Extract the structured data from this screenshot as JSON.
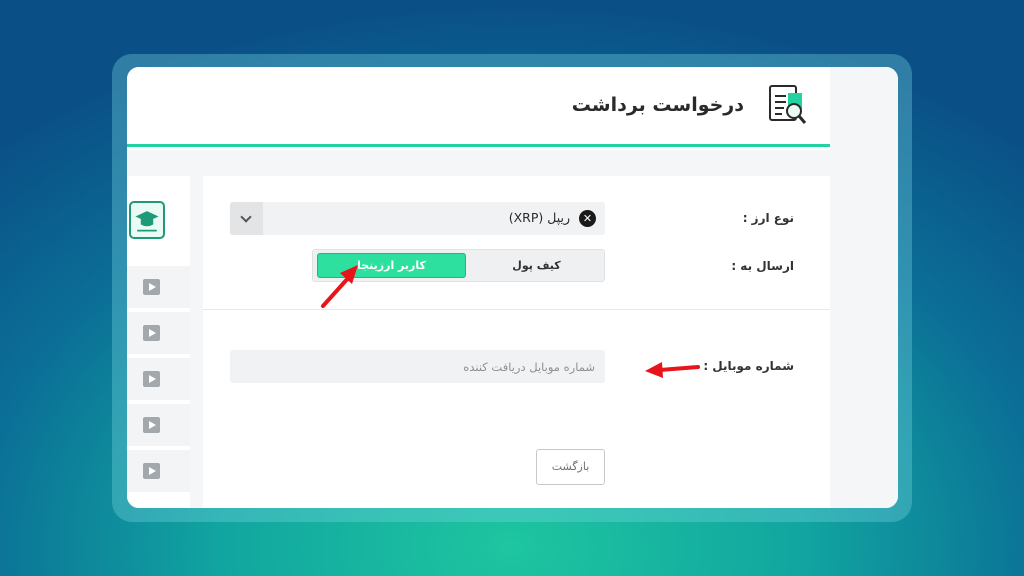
{
  "header": {
    "title": "درخواست برداشت",
    "icon": "receipt-search-icon"
  },
  "form": {
    "currency_label": "نوع ارز :",
    "currency_value": "ریپل (XRP)",
    "currency_icon": "xrp-icon",
    "send_to_label": "ارسال به :",
    "send_to_options": [
      "کاربر ارزینجا",
      "کیف پول"
    ],
    "send_to_selected": "کاربر ارزینجا",
    "mobile_label": "شماره موبایل :",
    "mobile_placeholder": "شماره موبایل دریافت کننده",
    "mobile_value": "",
    "back_label": "بازگشت"
  },
  "sidebar": {
    "logo_icon": "graduation-cap-icon",
    "items": [
      "play-icon",
      "play-icon",
      "play-icon",
      "play-icon",
      "play-icon"
    ]
  },
  "colors": {
    "accent": "#2ee0a0",
    "header_border": "#22d3a1",
    "annotation_arrow": "#e8141a"
  }
}
